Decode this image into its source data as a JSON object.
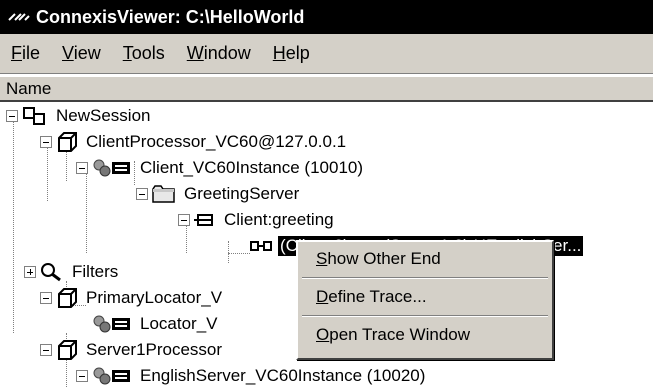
{
  "window": {
    "title": "ConnexisViewer: C:\\HelloWorld"
  },
  "menu": [
    {
      "prefix": "",
      "mnemonic": "F",
      "rest": "ile"
    },
    {
      "prefix": "",
      "mnemonic": "V",
      "rest": "iew"
    },
    {
      "prefix": "",
      "mnemonic": "T",
      "rest": "ools"
    },
    {
      "prefix": "",
      "mnemonic": "W",
      "rest": "indow"
    },
    {
      "prefix": "",
      "mnemonic": "H",
      "rest": "elp"
    }
  ],
  "header": {
    "column": "Name"
  },
  "tree": {
    "n0": {
      "label": "NewSession",
      "icon": "session-icon"
    },
    "n1": {
      "label": "ClientProcessor_VC60@127.0.0.1",
      "icon": "processor-icon"
    },
    "n2": {
      "label": "Client_VC60Instance (10010)",
      "icon": "instance-icon"
    },
    "n3": {
      "label": "GreetingServer",
      "icon": "folder-icon"
    },
    "n4": {
      "label": "Client:greeting",
      "icon": "port-icon"
    },
    "n5": {
      "label": "(Client:2) <-> (Server1:2) HEnglishSer...",
      "icon": "connection-icon"
    },
    "n6": {
      "label": "Filters",
      "icon": "filter-icon"
    },
    "n7": {
      "label": "PrimaryLocator_V",
      "icon": "processor-icon"
    },
    "n8": {
      "label": "Locator_V",
      "icon": "instance-icon"
    },
    "n9": {
      "label": "Server1Processor",
      "icon": "processor-icon"
    },
    "n10": {
      "label": "EnglishServer_VC60Instance (10020)",
      "icon": "instance-icon"
    }
  },
  "context_menu": {
    "items": [
      {
        "mnemonic": "S",
        "rest": "how Other End"
      },
      {
        "mnemonic": "D",
        "rest": "efine Trace..."
      },
      {
        "mnemonic": "O",
        "rest": "pen Trace Window"
      }
    ]
  }
}
